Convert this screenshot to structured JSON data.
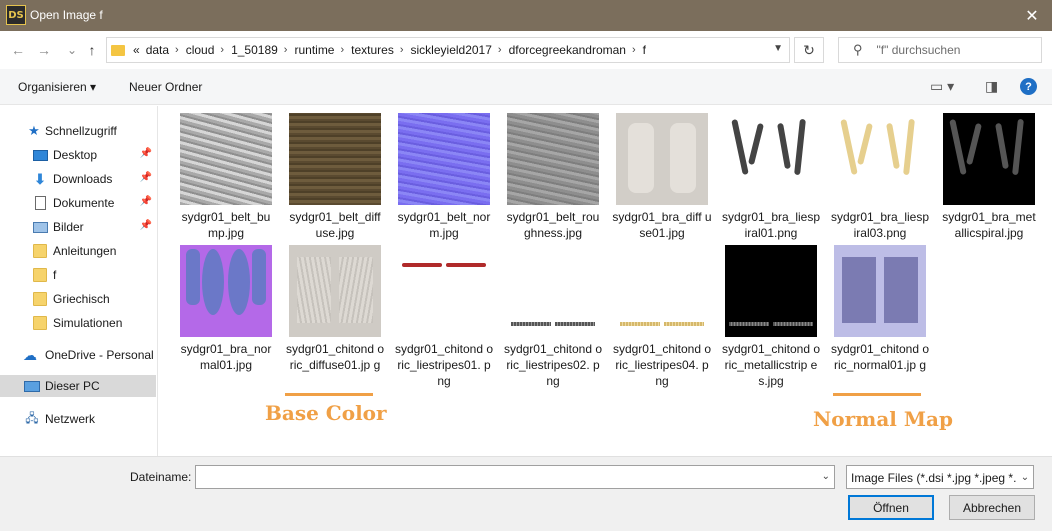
{
  "window": {
    "app_icon_text": "DS",
    "title": "Open Image f",
    "close_glyph": "✕"
  },
  "nav": {
    "back_glyph": "←",
    "forward_glyph": "→",
    "recent_glyph": "⌄",
    "up_glyph": "↑",
    "breadcrumb_overflow": "«",
    "breadcrumb": [
      "data",
      "cloud",
      "1_50189",
      "runtime",
      "textures",
      "sickleyield2017",
      "dforcegreekandroman",
      "f"
    ],
    "refresh_glyph": "↻",
    "search_placeholder": "\"f\" durchsuchen"
  },
  "toolbar": {
    "organize": "Organisieren",
    "new_folder": "Neuer Ordner",
    "help": "?"
  },
  "sidebar": {
    "quick_access": "Schnellzugriff",
    "items": [
      {
        "label": "Desktop",
        "pinned": true
      },
      {
        "label": "Downloads",
        "pinned": true
      },
      {
        "label": "Dokumente",
        "pinned": true
      },
      {
        "label": "Bilder",
        "pinned": true
      },
      {
        "label": "Anleitungen",
        "pinned": false
      },
      {
        "label": "f",
        "pinned": false
      },
      {
        "label": "Griechisch",
        "pinned": false
      },
      {
        "label": "Simulationen",
        "pinned": false
      }
    ],
    "onedrive": "OneDrive - Personal",
    "this_pc": "Dieser PC",
    "network": "Netzwerk"
  },
  "files": [
    {
      "name": "sydgr01_belt_bump.jpg",
      "display": "sydgr01_belt_bu mp.jpg"
    },
    {
      "name": "sydgr01_belt_diffuse.jpg",
      "display": "sydgr01_belt_diff use.jpg"
    },
    {
      "name": "sydgr01_belt_norm.jpg",
      "display": "sydgr01_belt_nor m.jpg"
    },
    {
      "name": "sydgr01_belt_roughness.jpg",
      "display": "sydgr01_belt_rou ghness.jpg"
    },
    {
      "name": "sydgr01_bra_diffuse01.jpg",
      "display": "sydgr01_bra_diff use01.jpg"
    },
    {
      "name": "sydgr01_bra_liespiral01.png",
      "display": "sydgr01_bra_liesp iral01.png"
    },
    {
      "name": "sydgr01_bra_liespiral03.png",
      "display": "sydgr01_bra_liesp iral03.png"
    },
    {
      "name": "sydgr01_bra_metallicspiral.jpg",
      "display": "sydgr01_bra_met allicspiral.jpg"
    },
    {
      "name": "sydgr01_bra_normal01.jpg",
      "display": "sydgr01_bra_nor mal01.jpg"
    },
    {
      "name": "sydgr01_chitondoric_diffuse01.jpg",
      "display": "sydgr01_chitond oric_diffuse01.jp g"
    },
    {
      "name": "sydgr01_chitondoric_liestripes01.png",
      "display": "sydgr01_chitond oric_liestripes01. png"
    },
    {
      "name": "sydgr01_chitondoric_liestripes02.png",
      "display": "sydgr01_chitond oric_liestripes02. png"
    },
    {
      "name": "sydgr01_chitondoric_liestripes04.png",
      "display": "sydgr01_chitond oric_liestripes04. png"
    },
    {
      "name": "sydgr01_chitondoric_metallicstripes.jpg",
      "display": "sydgr01_chitond oric_metallicstrip es.jpg"
    },
    {
      "name": "sydgr01_chitondoric_normal01.jpg",
      "display": "sydgr01_chitond oric_normal01.jp g"
    }
  ],
  "annotations": {
    "base_color": "Base Color",
    "normal_map": "Normal Map",
    "color": "#f0a046"
  },
  "bottom": {
    "filename_label": "Dateiname:",
    "filename_value": "",
    "filetype": "Image Files (*.dsi *.jpg *.jpeg *.p",
    "open": "Öffnen",
    "cancel": "Abbrechen"
  }
}
